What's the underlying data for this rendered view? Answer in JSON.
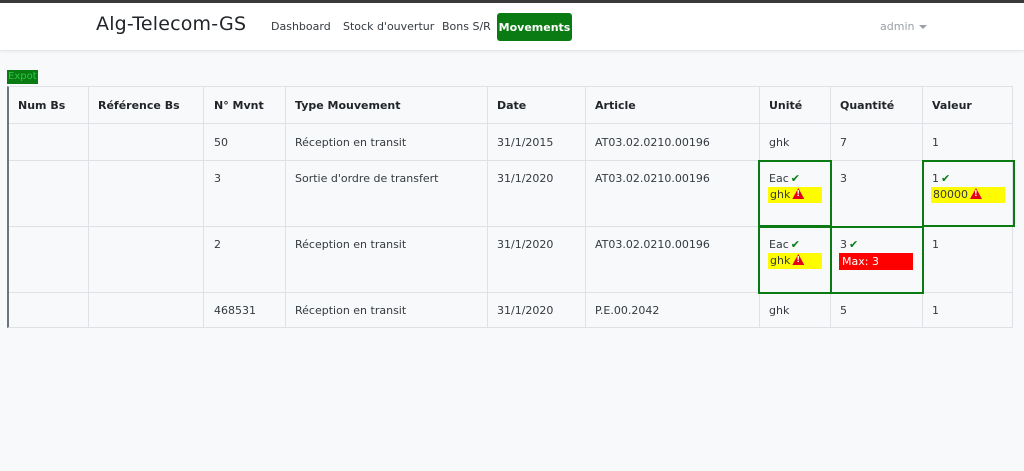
{
  "app": {
    "brand": "Alg-Telecom-GS"
  },
  "nav": {
    "items": [
      "Dashboard",
      "Stock d'ouvertur",
      "Bons S/R"
    ],
    "active": "Movements",
    "user": "admin"
  },
  "toolbar": {
    "export_label": "Expot"
  },
  "table": {
    "headers": [
      "Num Bs",
      "Référence Bs",
      "N° Mvnt",
      "Type Mouvement",
      "Date",
      "Article",
      "Unité",
      "Quantité",
      "Valeur"
    ],
    "rows": [
      {
        "num_bs": "",
        "ref_bs": "",
        "mvnt": "50",
        "type": "Réception en transit",
        "date": "31/1/2015",
        "article": "AT03.02.0210.00196",
        "unite": "ghk",
        "quantite": "7",
        "valeur": "1"
      },
      {
        "num_bs": "",
        "ref_bs": "",
        "mvnt": "3",
        "type": "Sortie d'ordre de transfert",
        "date": "31/1/2020",
        "article": "AT03.02.0210.00196",
        "unite_ok": "Eac",
        "unite_warn": "ghk",
        "quantite": "3",
        "valeur_ok": "1",
        "valeur_warn": "80000"
      },
      {
        "num_bs": "",
        "ref_bs": "",
        "mvnt": "2",
        "type": "Réception en transit",
        "date": "31/1/2020",
        "article": "AT03.02.0210.00196",
        "unite_ok": "Eac",
        "unite_warn": "ghk",
        "quantite_ok": "3",
        "quantite_max": "Max: 3",
        "valeur": "1"
      },
      {
        "num_bs": "",
        "ref_bs": "",
        "mvnt": "468531",
        "type": "Réception en transit",
        "date": "31/1/2020",
        "article": "P.E.00.2042",
        "unite": "ghk",
        "quantite": "5",
        "valeur": "1"
      }
    ]
  },
  "icons": {
    "ok": "check-icon",
    "warning": "warning-triangle-icon"
  },
  "colors": {
    "accent": "#0a7a12",
    "warning_bg": "#fffb00",
    "error_bg": "#ff0000",
    "warning_icon": "#e4001b"
  }
}
